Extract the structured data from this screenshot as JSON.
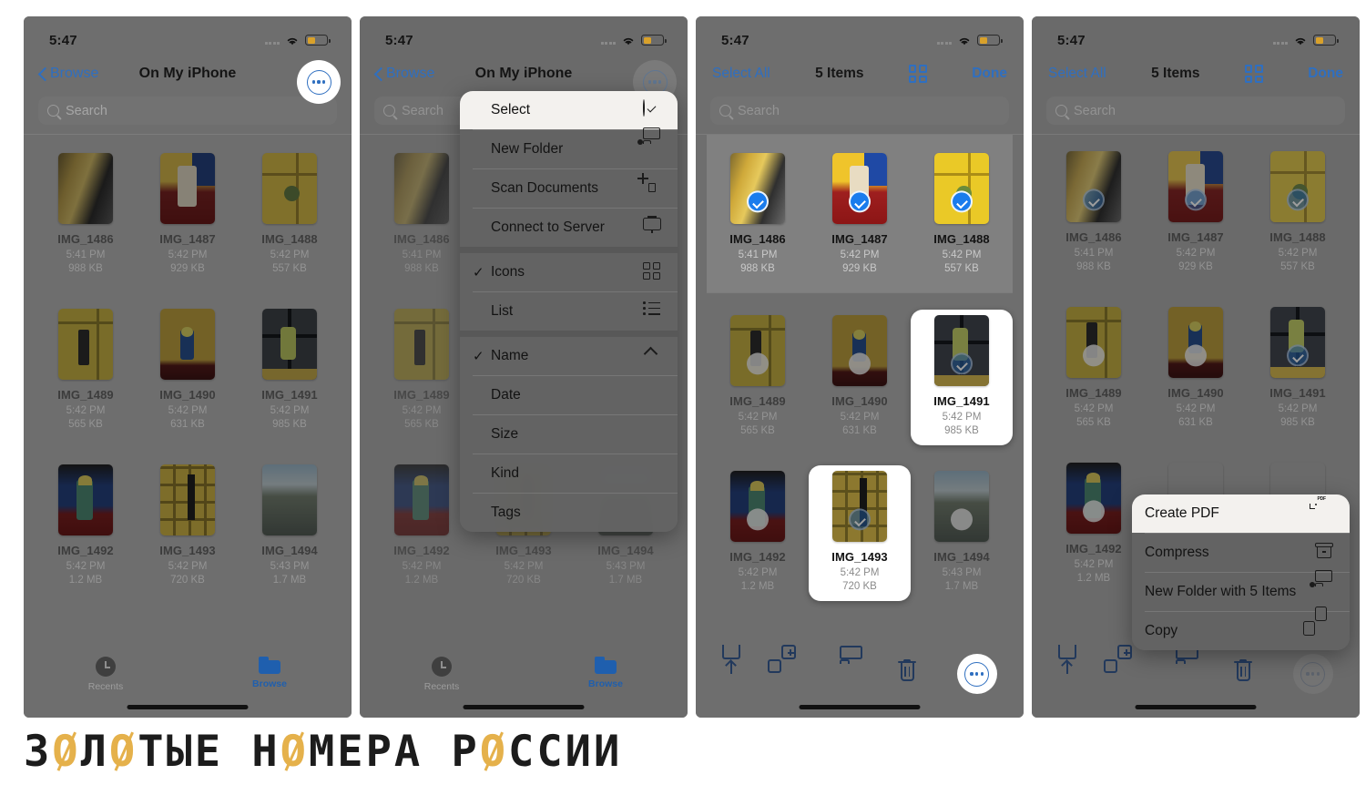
{
  "status": {
    "time": "5:47",
    "wifi_icon": "wifi-icon",
    "battery_icon": "battery-icon",
    "signal_icon": "cellular-signal-icon"
  },
  "browse_nav": {
    "back_label": "Browse",
    "title": "On My iPhone",
    "more_icon": "ellipsis-circle-icon"
  },
  "select_nav": {
    "select_all_label": "Select All",
    "count_label": "5 Items",
    "grid_icon": "grid-view-icon",
    "done_label": "Done"
  },
  "search": {
    "placeholder": "Search",
    "icon": "search-icon"
  },
  "files": [
    {
      "name": "IMG_1486",
      "time": "5:41 PM",
      "size": "988 KB"
    },
    {
      "name": "IMG_1487",
      "time": "5:42 PM",
      "size": "929 KB"
    },
    {
      "name": "IMG_1488",
      "time": "5:42 PM",
      "size": "557 KB"
    },
    {
      "name": "IMG_1489",
      "time": "5:42 PM",
      "size": "565 KB"
    },
    {
      "name": "IMG_1490",
      "time": "5:42 PM",
      "size": "631 KB"
    },
    {
      "name": "IMG_1491",
      "time": "5:42 PM",
      "size": "985 KB"
    },
    {
      "name": "IMG_1492",
      "time": "5:42 PM",
      "size": "1.2 MB"
    },
    {
      "name": "IMG_1493",
      "time": "5:42 PM",
      "size": "720 KB"
    },
    {
      "name": "IMG_1494",
      "time": "5:43 PM",
      "size": "1.7 MB"
    }
  ],
  "options_menu": {
    "items": [
      {
        "label": "Select",
        "icon": "checkmark-circle-icon"
      },
      {
        "label": "New Folder",
        "icon": "new-folder-icon"
      },
      {
        "label": "Scan Documents",
        "icon": "scan-documents-icon"
      },
      {
        "label": "Connect to Server",
        "icon": "connect-to-server-icon"
      },
      {
        "label": "Icons",
        "icon": "icons-view-icon"
      },
      {
        "label": "List",
        "icon": "list-view-icon"
      },
      {
        "label": "Name",
        "icon": "chevron-up-icon"
      },
      {
        "label": "Date",
        "icon": ""
      },
      {
        "label": "Size",
        "icon": ""
      },
      {
        "label": "Kind",
        "icon": ""
      },
      {
        "label": "Tags",
        "icon": ""
      }
    ],
    "check_glyph": "✓"
  },
  "action_menu": {
    "items": [
      {
        "label": "Create PDF",
        "icon": "pdf-document-icon"
      },
      {
        "label": "Compress",
        "icon": "compress-icon"
      },
      {
        "label": "New Folder with 5 Items",
        "icon": "new-folder-icon"
      },
      {
        "label": "Copy",
        "icon": "copy-icon"
      }
    ]
  },
  "tabbar": {
    "recents_label": "Recents",
    "recents_icon": "clock-icon",
    "browse_label": "Browse",
    "browse_icon": "folder-icon"
  },
  "action_toolbar": {
    "share_icon": "share-icon",
    "duplicate_icon": "duplicate-icon",
    "move_icon": "folder-icon",
    "delete_icon": "trash-icon",
    "more_icon": "ellipsis-circle-icon"
  },
  "watermark": {
    "text": "ЗОЛОТЫЕ НОМЕРА РОССИИ"
  },
  "colors": {
    "accent_blue": "#2f6fc0",
    "selection_blue": "#1a7ced",
    "battery_amber": "#d9a12a",
    "watermark_gold": "#e5b14b",
    "tab_active": "#1f5fae"
  }
}
